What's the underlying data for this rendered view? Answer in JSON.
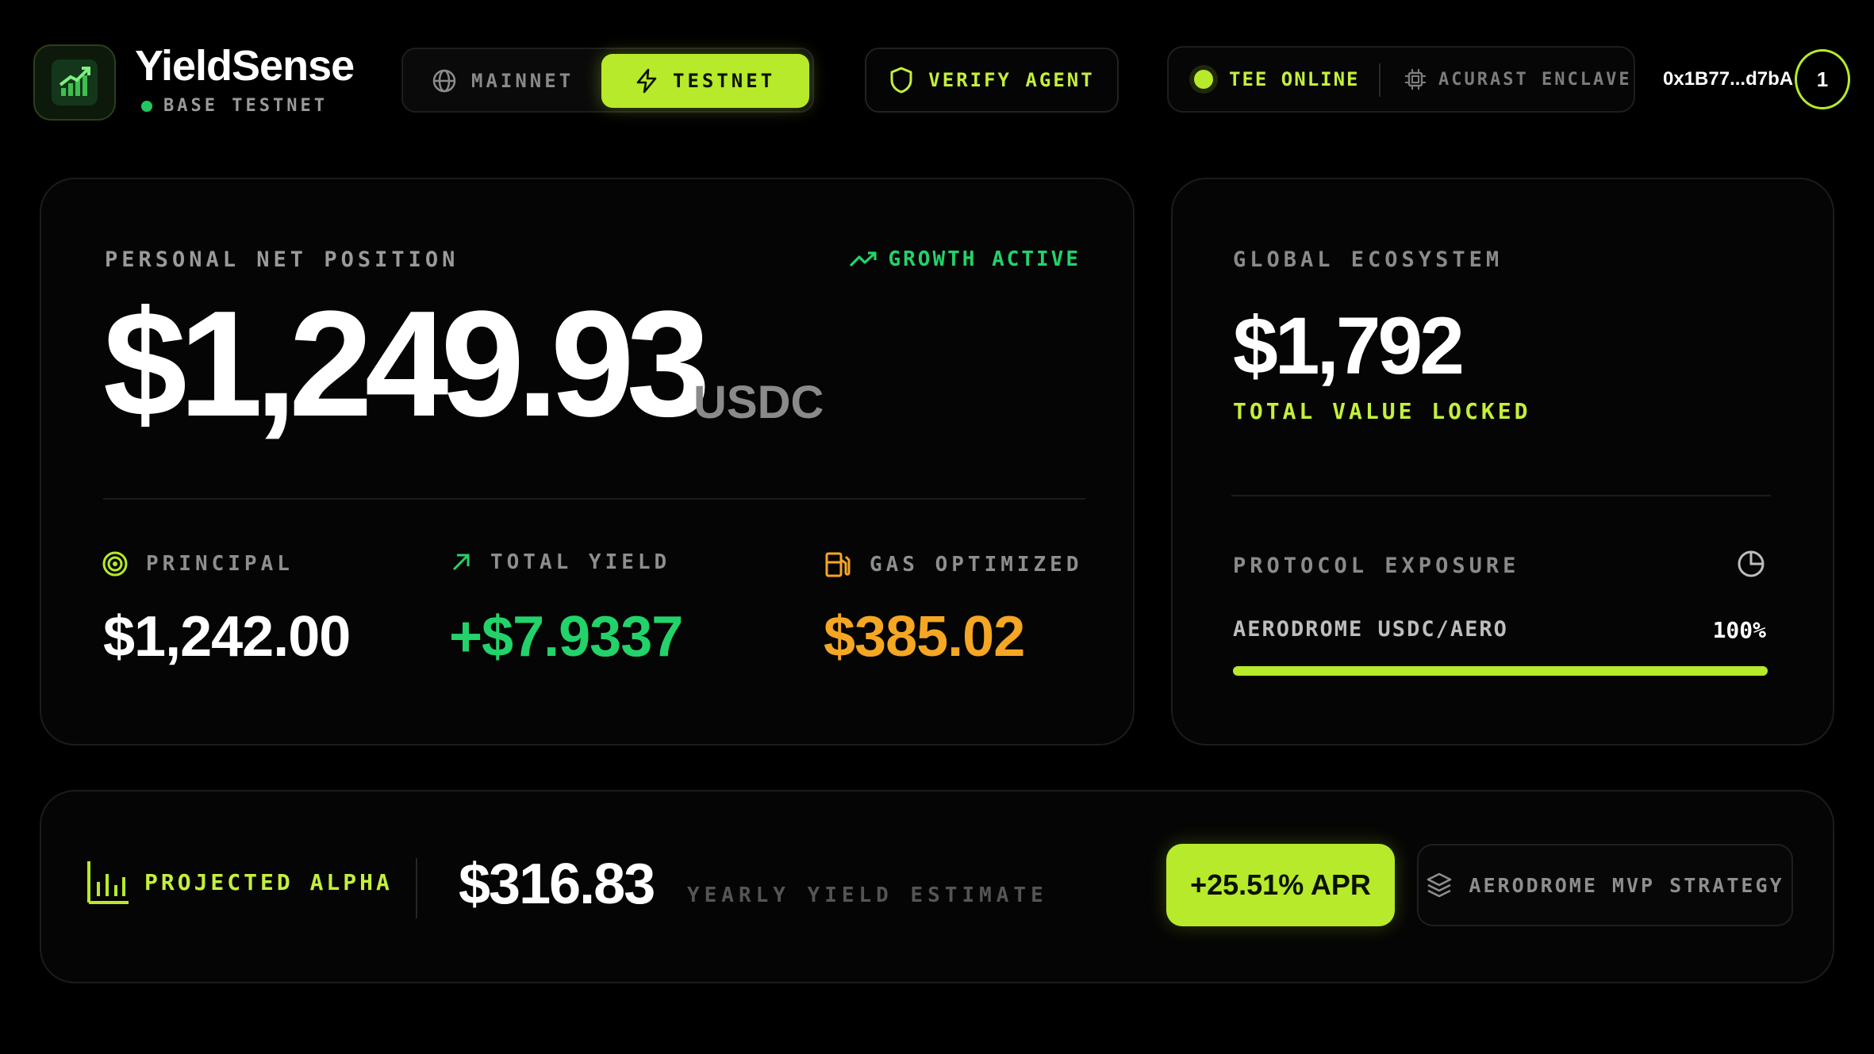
{
  "brand": {
    "name": "YieldSense",
    "network_label": "BASE TESTNET",
    "logo_icon": "growth-chart-icon"
  },
  "network_switch": {
    "mainnet_label": "MAINNET",
    "testnet_label": "TESTNET",
    "selected": "TESTNET"
  },
  "verify": {
    "label": "VERIFY AGENT"
  },
  "tee_status": {
    "online_label": "TEE ONLINE",
    "enclave_label": "ACURAST ENCLAVE"
  },
  "wallet": {
    "address": "0x1B77...d7bA",
    "notification_count": "1"
  },
  "position": {
    "title": "PERSONAL NET POSITION",
    "status": "GROWTH ACTIVE",
    "amount": "$1,249.93",
    "unit": "USDC",
    "principal_label": "PRINCIPAL",
    "principal_value": "$1,242.00",
    "yield_label": "TOTAL YIELD",
    "yield_value": "+$7.9337",
    "gas_label": "GAS OPTIMIZED",
    "gas_value": "$385.02"
  },
  "global": {
    "title": "GLOBAL ECOSYSTEM",
    "tvl_amount": "$1,792",
    "tvl_label": "TOTAL VALUE LOCKED",
    "exposure_title": "PROTOCOL EXPOSURE",
    "exposure_name": "AERODROME USDC/AERO",
    "exposure_pct_label": "100%",
    "exposure_fraction": 1.0
  },
  "alpha": {
    "label": "PROJECTED ALPHA",
    "amount": "$316.83",
    "sub_label": "YEARLY YIELD ESTIMATE",
    "apr_label": "+25.51% APR",
    "strategy_label": "AERODROME MVP STRATEGY"
  },
  "colors": {
    "accent": "#b7ea2a",
    "positive": "#22d36a",
    "gas": "#f5a623",
    "background": "#000000"
  }
}
